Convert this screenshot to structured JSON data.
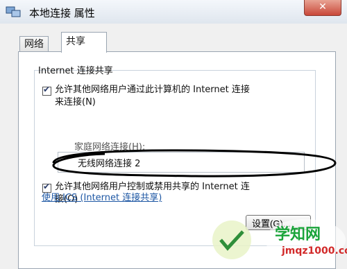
{
  "window": {
    "title": "本地连接 属性",
    "close_glyph": "✕"
  },
  "tabs": [
    {
      "label": "网络"
    },
    {
      "label": "共享",
      "active": true
    }
  ],
  "sharing": {
    "group_title": "Internet 连接共享",
    "allow_share": {
      "checked": true,
      "line1": "允许其他网络用户通过此计算机的 Internet 连接",
      "line2": "来连接(N)"
    },
    "home_network_label": "家庭网络连接(H):",
    "home_network_value": "无线网络连接 2",
    "allow_control": {
      "checked": true,
      "line1": "允许其他网络用户控制或禁用共享的 Internet 连",
      "line2": "接(O)"
    },
    "ics_link": "使用 ICS (Internet 连接共享)",
    "settings_button": "设置(G)..."
  },
  "watermark": {
    "brand": "学知网",
    "url": "jmqz1000.com"
  },
  "colors": {
    "link": "#1c56a3",
    "annotation": "#000000",
    "brand_green": "#1aa43a"
  }
}
